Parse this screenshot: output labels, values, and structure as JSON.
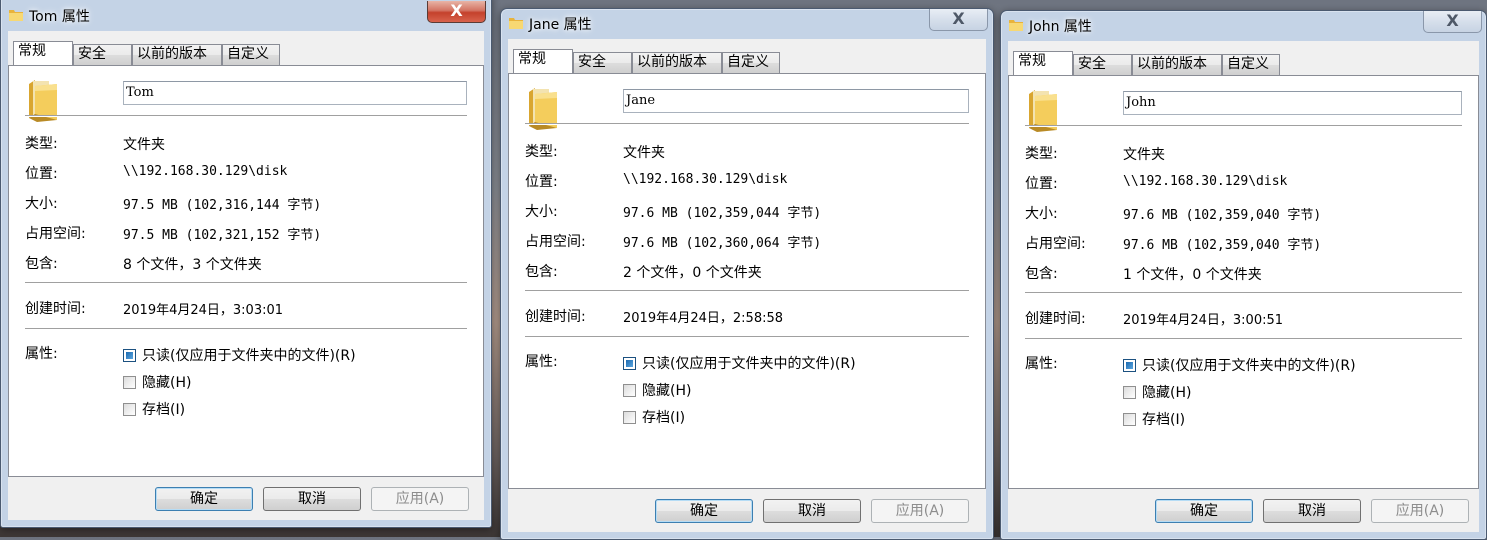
{
  "tabs": [
    "常规",
    "安全",
    "以前的版本",
    "自定义"
  ],
  "labels": {
    "type": "类型:",
    "location": "位置:",
    "size": "大小:",
    "size_on_disk": "占用空间:",
    "contains": "包含:",
    "created": "创建时间:",
    "attributes": "属性:"
  },
  "attributes": {
    "readonly": "只读(仅应用于文件夹中的文件)(R)",
    "hidden": "隐藏(H)",
    "archive": "存档(I)"
  },
  "buttons": {
    "ok": "确定",
    "cancel": "取消",
    "apply": "应用(A)"
  },
  "close_glyph": "X",
  "windows": [
    {
      "title": "Tom 属性",
      "name": "Tom",
      "type": "文件夹",
      "location": "\\\\192.168.30.129\\disk",
      "size": "97.5 MB (102,316,144 字节)",
      "size_on_disk": "97.5 MB (102,321,152 字节)",
      "contains": "8 个文件，3 个文件夹",
      "created": "2019年4月24日，3:03:01"
    },
    {
      "title": "Jane 属性",
      "name": "Jane",
      "type": "文件夹",
      "location": "\\\\192.168.30.129\\disk",
      "size": "97.6 MB (102,359,044 字节)",
      "size_on_disk": "97.6 MB (102,360,064 字节)",
      "contains": "2 个文件，0 个文件夹",
      "created": "2019年4月24日，2:58:58"
    },
    {
      "title": "John 属性",
      "name": "John",
      "type": "文件夹",
      "location": "\\\\192.168.30.129\\disk",
      "size": "97.6 MB (102,359,040 字节)",
      "size_on_disk": "97.6 MB (102,359,040 字节)",
      "contains": "1 个文件，0 个文件夹",
      "created": "2019年4月24日，3:00:51"
    }
  ]
}
